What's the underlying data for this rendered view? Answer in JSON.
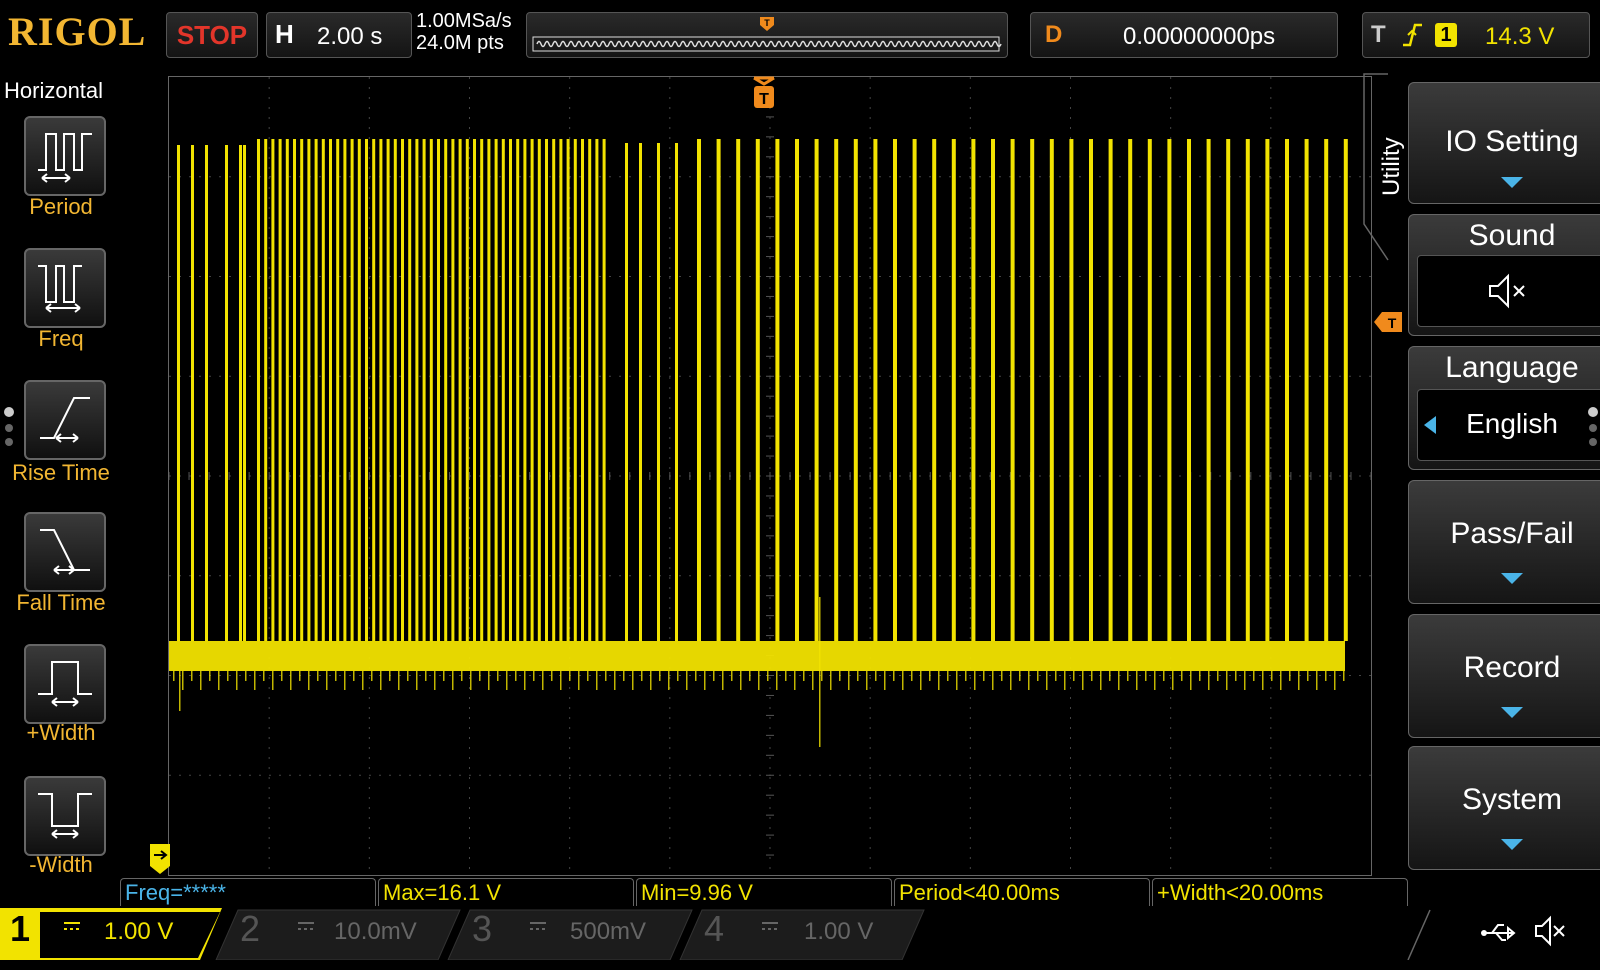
{
  "header": {
    "brand": "RIGOL",
    "run_state": "STOP",
    "horizontal_label": "H",
    "timebase": "2.00 s",
    "sample_rate": "1.00MSa/s",
    "memory_depth": "24.0M pts",
    "delay_label": "D",
    "delay_value": "0.00000000ps",
    "trigger_label": "T",
    "trigger_channel": "1",
    "trigger_level": "14.3 V"
  },
  "left_menu": {
    "title": "Horizontal",
    "items": [
      {
        "label": "Period"
      },
      {
        "label": "Freq"
      },
      {
        "label": "Rise Time"
      },
      {
        "label": "Fall Time"
      },
      {
        "label": "+Width"
      },
      {
        "label": "-Width"
      }
    ]
  },
  "right_menu": {
    "section": "Utility",
    "io_setting": "IO Setting",
    "sound_label": "Sound",
    "language_label": "Language",
    "language_value": "English",
    "pass_fail": "Pass/Fail",
    "record": "Record",
    "system": "System"
  },
  "measurements": [
    "Freq=*****",
    "Max=16.1 V",
    "Min=9.96 V",
    "Period<40.00ms",
    "+Width<20.00ms"
  ],
  "channels": [
    {
      "number": "1",
      "scale": "1.00 V",
      "color": "#f2e300",
      "active": true
    },
    {
      "number": "2",
      "scale": "10.0mV",
      "color": "#4ab4e8",
      "active": false
    },
    {
      "number": "3",
      "scale": "500mV",
      "color": "#c040c0",
      "active": false
    },
    {
      "number": "4",
      "scale": "1.00 V",
      "color": "#3060e0",
      "active": false
    }
  ],
  "colors": {
    "trace": "#f2e300",
    "accent_orange": "#f08a1c",
    "brand": "#f2b632",
    "arrow_blue": "#4ab4e8"
  },
  "status_icons": [
    "usb-icon",
    "sound-muted-icon"
  ]
}
